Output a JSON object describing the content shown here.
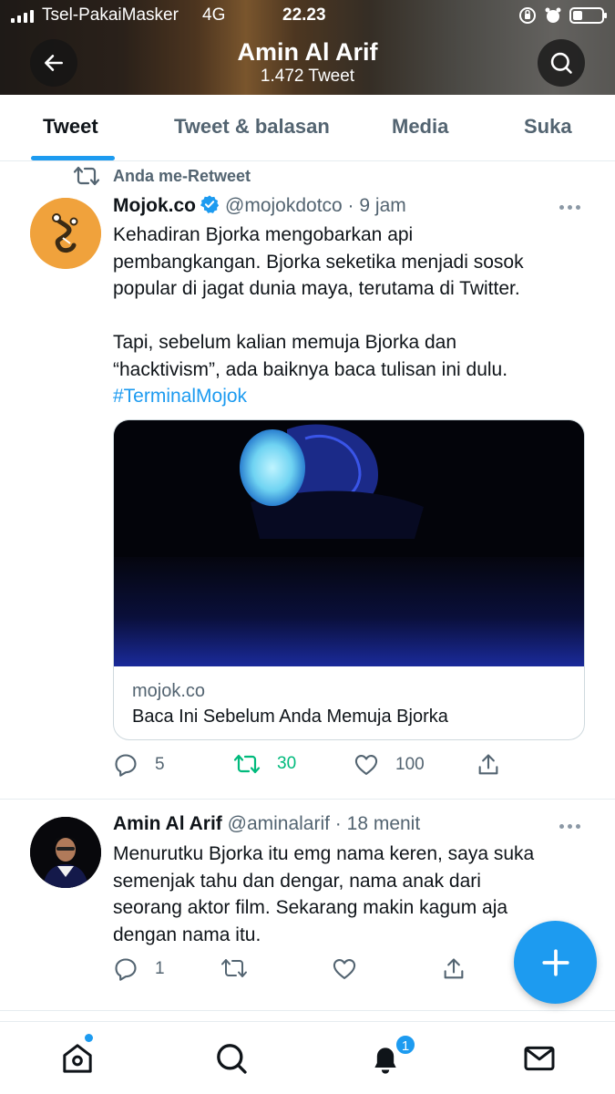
{
  "status_bar": {
    "carrier": "Tsel-PakaiMasker",
    "network": "4G",
    "time": "22.23"
  },
  "header": {
    "name": "Amin Al Arif",
    "tweet_count": "1.472 Tweet"
  },
  "tabs": [
    {
      "label": "Tweet",
      "active": true
    },
    {
      "label": "Tweet & balasan",
      "active": false
    },
    {
      "label": "Media",
      "active": false
    },
    {
      "label": "Suka",
      "active": false
    }
  ],
  "tweets": [
    {
      "social_context": "Anda me-Retweet",
      "name": "Mojok.co",
      "verified": true,
      "handle_time": "@mojokdotco · 9 jam",
      "lines": [
        "Kehadiran Bjorka mengobarkan api",
        "pembangkangan. Bjorka seketika menjadi sosok",
        "popular di jagat dunia maya, terutama di Twitter.",
        "",
        "Tapi, sebelum kalian memuja Bjorka dan",
        "“hacktivism”, ada baiknya baca tulisan ini dulu."
      ],
      "hashtag": "#TerminalMojok",
      "card": {
        "domain": "mojok.co",
        "title": "Baca Ini Sebelum Anda Memuja Bjorka"
      },
      "replies": "5",
      "retweets": "30",
      "likes": "100"
    },
    {
      "name": "Amin Al Arif",
      "handle_time": "@aminalarif · 18 menit",
      "lines": [
        "Menurutku Bjorka itu emg nama keren, saya suka",
        "semenjak tahu dan dengar, nama anak dari",
        "seorang aktor film. Sekarang makin kagum aja",
        "dengan nama itu."
      ],
      "replies": "1"
    }
  ],
  "bottom_nav": {
    "notification_badge": "1"
  },
  "colors": {
    "accent": "#1d9bf0",
    "retweet_active": "#00ba7c",
    "secondary_text": "#536471"
  }
}
